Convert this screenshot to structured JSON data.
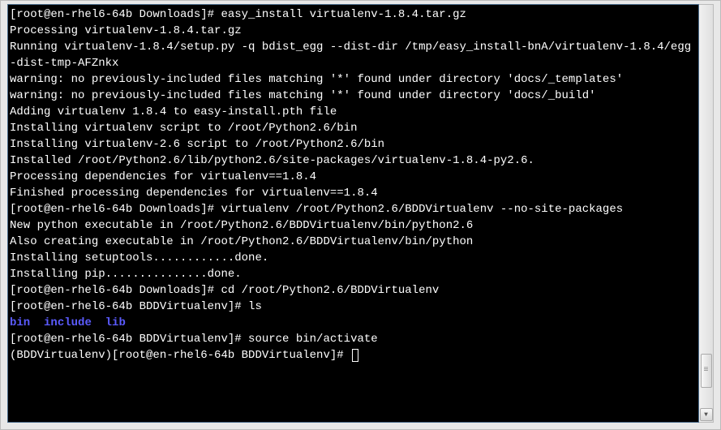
{
  "terminal": {
    "lines": [
      {
        "segs": [
          {
            "t": "[root@en-rhel6-64b Downloads]# easy_install virtualenv-1.8.4.tar.gz"
          }
        ]
      },
      {
        "segs": [
          {
            "t": "Processing virtualenv-1.8.4.tar.gz"
          }
        ]
      },
      {
        "segs": [
          {
            "t": "Running virtualenv-1.8.4/setup.py -q bdist_egg --dist-dir /tmp/easy_install-bnA/virtualenv-1.8.4/egg-dist-tmp-AFZnkx"
          }
        ]
      },
      {
        "segs": [
          {
            "t": "warning: no previously-included files matching '*' found under directory 'docs/_templates'"
          }
        ]
      },
      {
        "segs": [
          {
            "t": "warning: no previously-included files matching '*' found under directory 'docs/_build'"
          }
        ]
      },
      {
        "segs": [
          {
            "t": "Adding virtualenv 1.8.4 to easy-install.pth file"
          }
        ]
      },
      {
        "segs": [
          {
            "t": "Installing virtualenv script to /root/Python2.6/bin"
          }
        ]
      },
      {
        "segs": [
          {
            "t": "Installing virtualenv-2.6 script to /root/Python2.6/bin"
          }
        ]
      },
      {
        "segs": [
          {
            "t": ""
          }
        ]
      },
      {
        "segs": [
          {
            "t": "Installed /root/Python2.6/lib/python2.6/site-packages/virtualenv-1.8.4-py2.6."
          }
        ]
      },
      {
        "segs": [
          {
            "t": "Processing dependencies for virtualenv==1.8.4"
          }
        ]
      },
      {
        "segs": [
          {
            "t": "Finished processing dependencies for virtualenv==1.8.4"
          }
        ]
      },
      {
        "segs": [
          {
            "t": "[root@en-rhel6-64b Downloads]# virtualenv /root/Python2.6/BDDVirtualenv --no-site-packages"
          }
        ]
      },
      {
        "segs": [
          {
            "t": "New python executable in /root/Python2.6/BDDVirtualenv/bin/python2.6"
          }
        ]
      },
      {
        "segs": [
          {
            "t": "Also creating executable in /root/Python2.6/BDDVirtualenv/bin/python"
          }
        ]
      },
      {
        "segs": [
          {
            "t": "Installing setuptools............done."
          }
        ]
      },
      {
        "segs": [
          {
            "t": "Installing pip...............done."
          }
        ]
      },
      {
        "segs": [
          {
            "t": "[root@en-rhel6-64b Downloads]# cd /root/Python2.6/BDDVirtualenv"
          }
        ]
      },
      {
        "segs": [
          {
            "t": "[root@en-rhel6-64b BDDVirtualenv]# ls"
          }
        ]
      },
      {
        "segs": [
          {
            "t": "bin",
            "c": "dir"
          },
          {
            "t": "  "
          },
          {
            "t": "include",
            "c": "dir"
          },
          {
            "t": "  "
          },
          {
            "t": "lib",
            "c": "dir"
          }
        ]
      },
      {
        "segs": [
          {
            "t": "[root@en-rhel6-64b BDDVirtualenv]# source bin/activate"
          }
        ]
      },
      {
        "segs": [
          {
            "t": "(BDDVirtualenv)[root@en-rhel6-64b BDDVirtualenv]# "
          }
        ],
        "cursor": true
      }
    ]
  },
  "scroll": {
    "down": "▼"
  }
}
